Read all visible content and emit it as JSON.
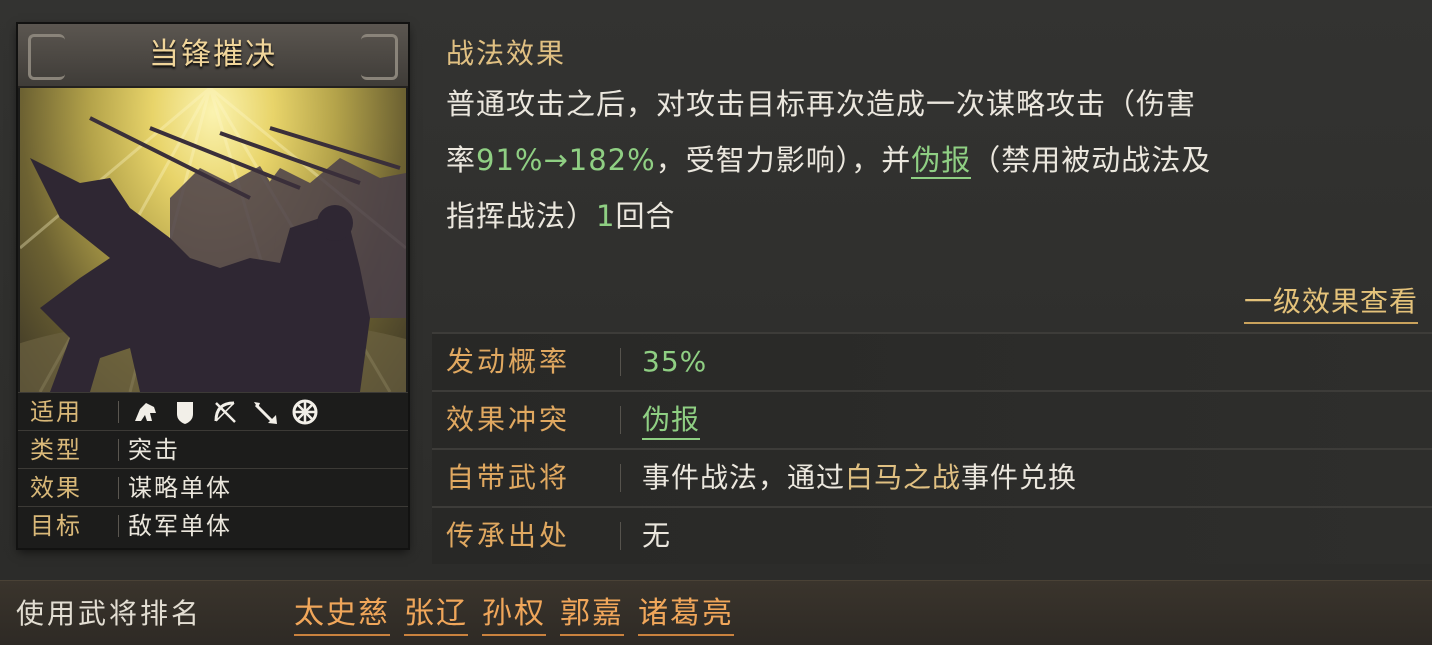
{
  "card": {
    "title": "当锋摧决",
    "info": [
      {
        "key": "适用",
        "type": "icons",
        "icons": [
          "cavalry-icon",
          "shield-icon",
          "archer-icon",
          "spear-icon",
          "siege-icon"
        ]
      },
      {
        "key": "类型",
        "value": "突击"
      },
      {
        "key": "效果",
        "value": "谋略单体"
      },
      {
        "key": "目标",
        "value": "敌军单体"
      }
    ]
  },
  "effect": {
    "section_title": "战法效果",
    "desc_1": "普通攻击之后，对攻击目标再次造成一次谋略攻击（伤害",
    "desc_2a": "率",
    "desc_2b": "91%→182%",
    "desc_2c": "，受智力影响），并",
    "desc_2d": "伪报",
    "desc_2e": "（禁用被动战法及",
    "desc_3a": "指挥战法）",
    "desc_3b": "1",
    "desc_3c": "回合",
    "level_link": "一级效果查看"
  },
  "attributes": [
    {
      "key": "发动概率",
      "value": "35%"
    },
    {
      "key": "效果冲突",
      "value": "伪报"
    },
    {
      "key": "自带武将",
      "value_a": "事件战法，通过",
      "value_b": "白马之战",
      "value_c": "事件兑换"
    },
    {
      "key": "传承出处",
      "value": "无"
    }
  ],
  "ranking": {
    "label": "使用武将排名",
    "generals": [
      "太史慈",
      "张辽",
      "孙权",
      "郭嘉",
      "诸葛亮"
    ]
  },
  "colors": {
    "accent_gold": "#e0c082",
    "highlight_green": "#8fcf83",
    "general_orange": "#f0a65a"
  }
}
